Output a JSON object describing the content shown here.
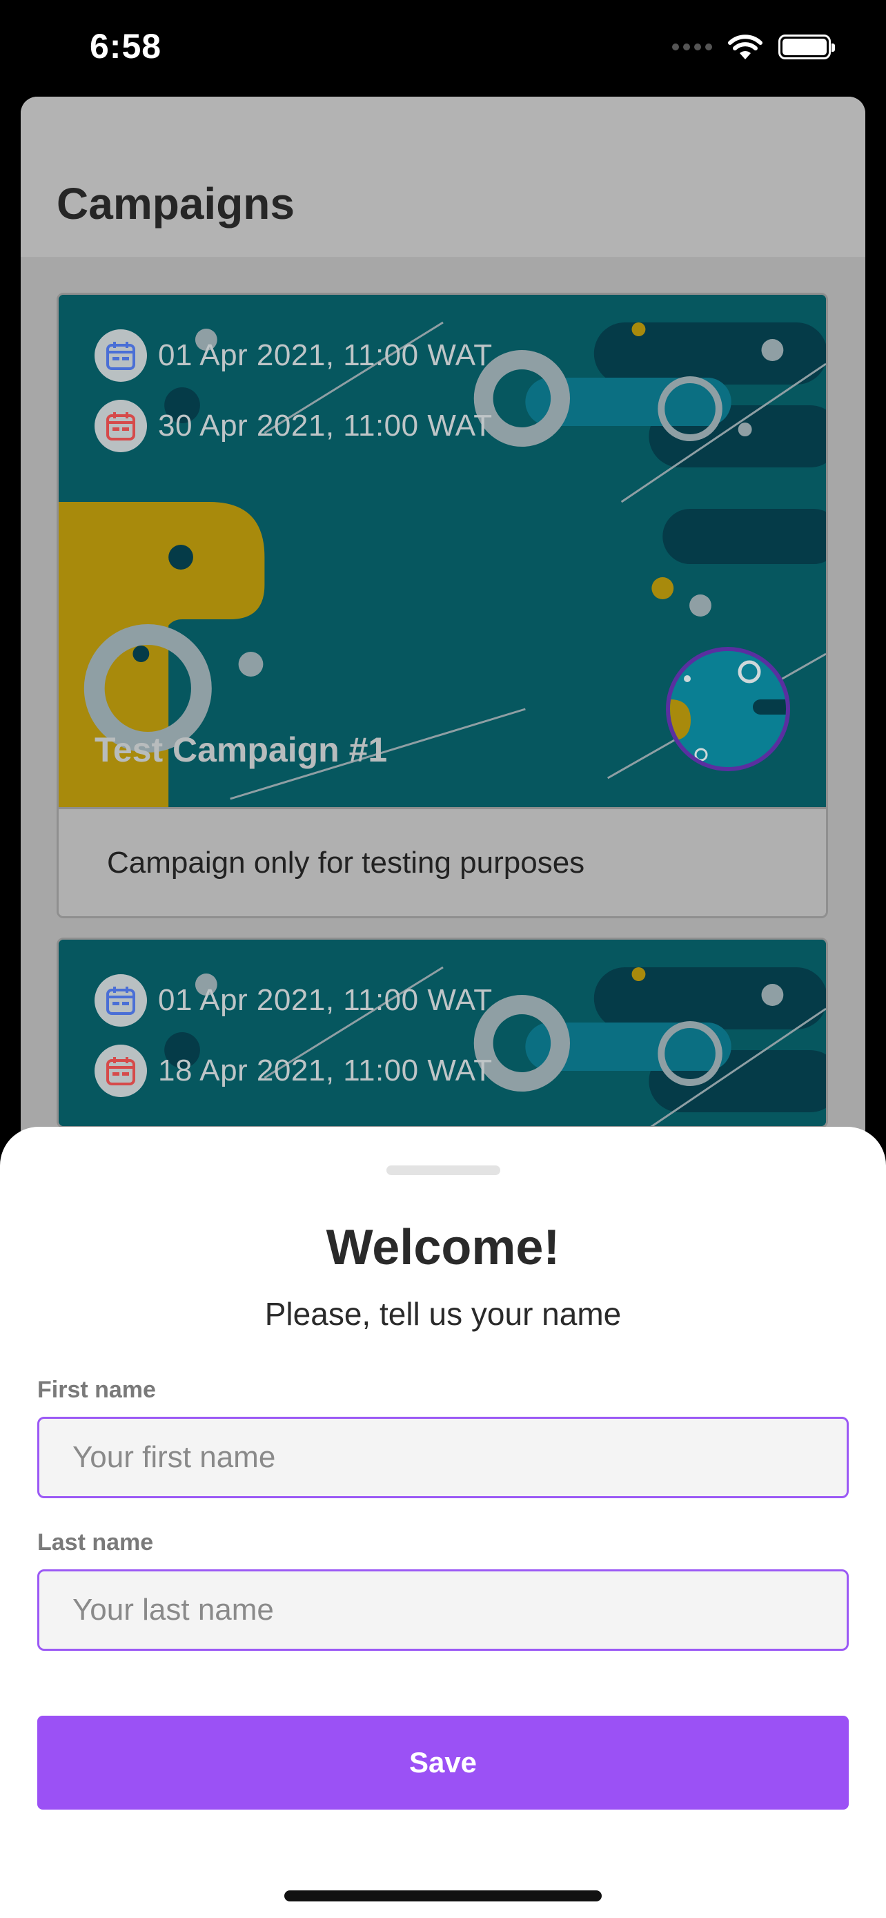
{
  "status_bar": {
    "time": "6:58"
  },
  "page": {
    "title": "Campaigns"
  },
  "campaigns": [
    {
      "start_date": "01 Apr 2021, 11:00 WAT",
      "end_date": "30 Apr 2021, 11:00 WAT",
      "title": "Test Campaign #1",
      "description": "Campaign only for testing purposes"
    },
    {
      "start_date": "01 Apr 2021, 11:00 WAT",
      "end_date": "18 Apr 2021, 11:00 WAT"
    }
  ],
  "welcome_sheet": {
    "title": "Welcome!",
    "subtitle": "Please, tell us your name",
    "first_name_label": "First name",
    "first_name_value": "",
    "first_name_placeholder": "Your first name",
    "last_name_label": "Last name",
    "last_name_value": "",
    "last_name_placeholder": "Your last name",
    "save_label": "Save"
  },
  "colors": {
    "accent": "#9b51f5",
    "banner": "#06575f",
    "start_icon": "#4a6fd6",
    "end_icon": "#d64a4a"
  }
}
